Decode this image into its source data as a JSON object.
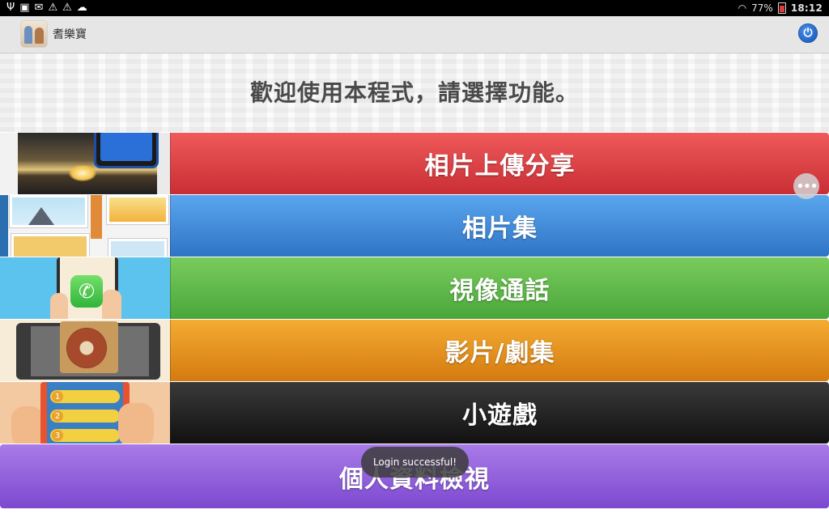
{
  "status_bar": {
    "icons": [
      "usb-icon",
      "image-icon",
      "mail-icon",
      "warning-icon",
      "warning-icon",
      "cloud-upload-icon"
    ],
    "wifi_icon": "wifi-icon",
    "battery_percent": "77%",
    "time": "18:12"
  },
  "action_bar": {
    "app_title": "耆樂寶",
    "power_icon": "power-icon"
  },
  "welcome": {
    "text": "歡迎使用本程式，請選擇功能。"
  },
  "menu": [
    {
      "label": "相片上傳分享",
      "color": "#d9363e"
    },
    {
      "label": "相片集",
      "color": "#3a83d6"
    },
    {
      "label": "視像通話",
      "color": "#5db848"
    },
    {
      "label": "影片/劇集",
      "color": "#e0891b"
    },
    {
      "label": "小遊戲",
      "color": "#1e1e1e"
    },
    {
      "label": "個人資料檢視",
      "color": "#8f5ed9"
    }
  ],
  "thumb_numbers": [
    "1",
    "2",
    "3"
  ],
  "toast": {
    "text": "Login successful!"
  }
}
